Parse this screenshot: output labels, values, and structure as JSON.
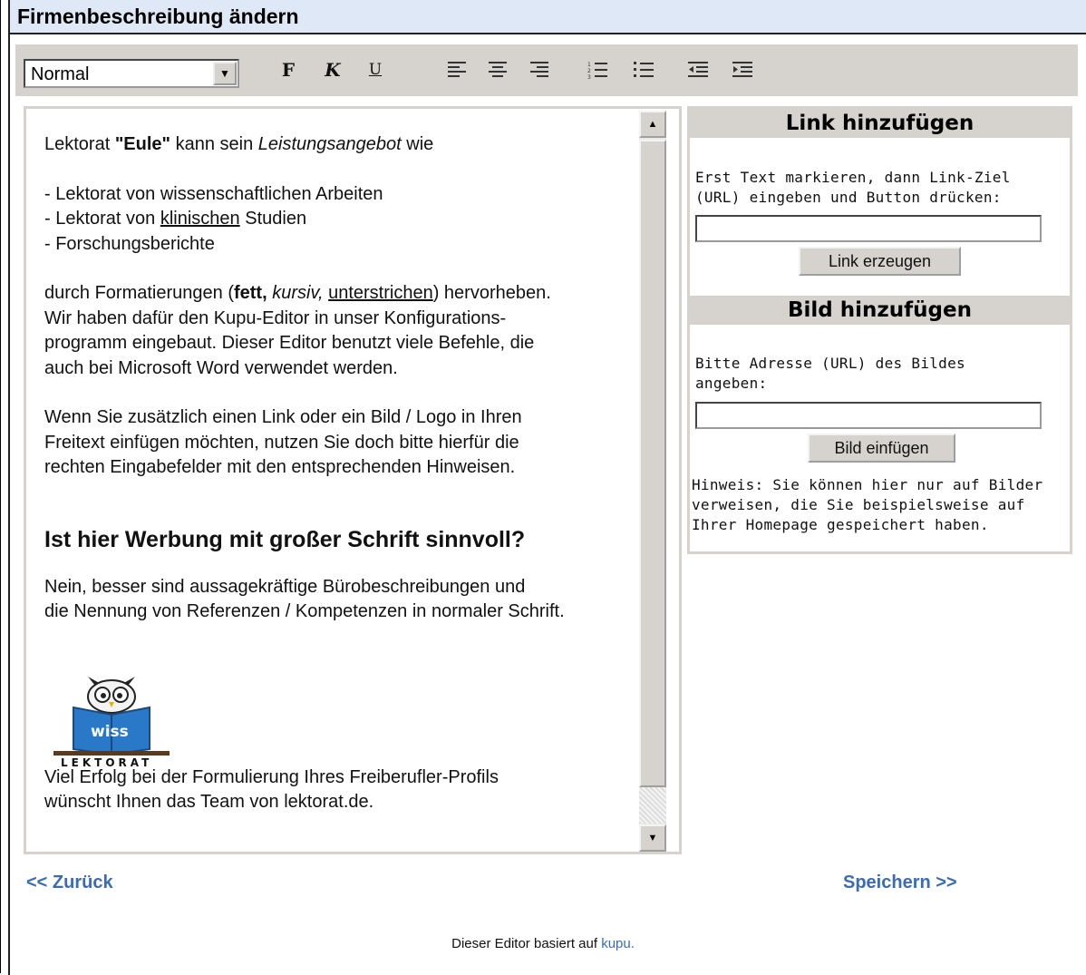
{
  "page": {
    "title": "Firmenbeschreibung ändern"
  },
  "toolbar": {
    "format_select": "Normal",
    "bold": "F",
    "italic": "K",
    "underline": "U"
  },
  "editor": {
    "intro_prefix": "Lektorat ",
    "intro_bold": "\"Eule\"",
    "intro_mid": " kann sein ",
    "intro_italic": "Leistungsangebot",
    "intro_suffix": " wie",
    "list1": "- Lektorat von wissenschaftlichen Arbeiten",
    "list2_prefix": "- Lektorat von ",
    "list2_underline": "klinischen",
    "list2_suffix": " Studien",
    "list3": "- Forschungsberichte",
    "p2_a": "durch Formatierungen (",
    "p2_bold": "fett,",
    "p2_italic": "kursiv,",
    "p2_underline": "unterstrichen",
    "p2_b": ") hervorheben.",
    "p2_line2": "Wir haben dafür den Kupu-Editor in unser Konfigurations-",
    "p2_line3": "programm eingebaut. Dieser Editor benutzt viele Befehle, die",
    "p2_line4": "auch bei Microsoft Word verwendet werden.",
    "p3_line1": "Wenn Sie zusätzlich einen Link oder ein Bild / Logo in Ihren",
    "p3_line2": "Freitext einfügen möchten, nutzen Sie doch bitte hierfür die",
    "p3_line3": "rechten Eingabefelder mit den entsprechenden Hinweisen.",
    "heading": "Ist hier Werbung mit großer Schrift sinnvoll?",
    "p4_line1": "Nein, besser sind aussagekräftige Bürobeschreibungen und",
    "p4_line2": "die Nennung von Referenzen / Kompetenzen in normaler Schrift.",
    "logo_top": "wiss",
    "logo_bottom": "LEKTORAT",
    "p5_line1": "Viel Erfolg bei der Formulierung Ihres Freiberufler-Profils",
    "p5_line2": "wünscht Ihnen das Team von lektorat.de."
  },
  "link_panel": {
    "title": "Link hinzufügen",
    "instructions_line1": "Erst Text markieren, dann Link-Ziel",
    "instructions_line2": "(URL) eingeben und Button drücken:",
    "input_value": "",
    "button": "Link erzeugen"
  },
  "image_panel": {
    "title": "Bild hinzufügen",
    "instructions_line1": "Bitte Adresse (URL) des Bildes",
    "instructions_line2": "angeben:",
    "input_value": "",
    "button": "Bild einfügen",
    "hint_line1": "Hinweis: Sie können hier nur auf Bilder",
    "hint_line2": "verweisen, die Sie beispielsweise auf",
    "hint_line3": "Ihrer Homepage gespeichert haben."
  },
  "nav": {
    "back": "<< Zurück",
    "save": "Speichern >>"
  },
  "footer": {
    "text": "Dieser Editor basiert auf ",
    "link": "kupu",
    "period": "."
  },
  "colors": {
    "title_bg": "#dfe8f6",
    "toolbar_bg": "#d6d3ce",
    "link_blue": "#3a6bb5"
  }
}
